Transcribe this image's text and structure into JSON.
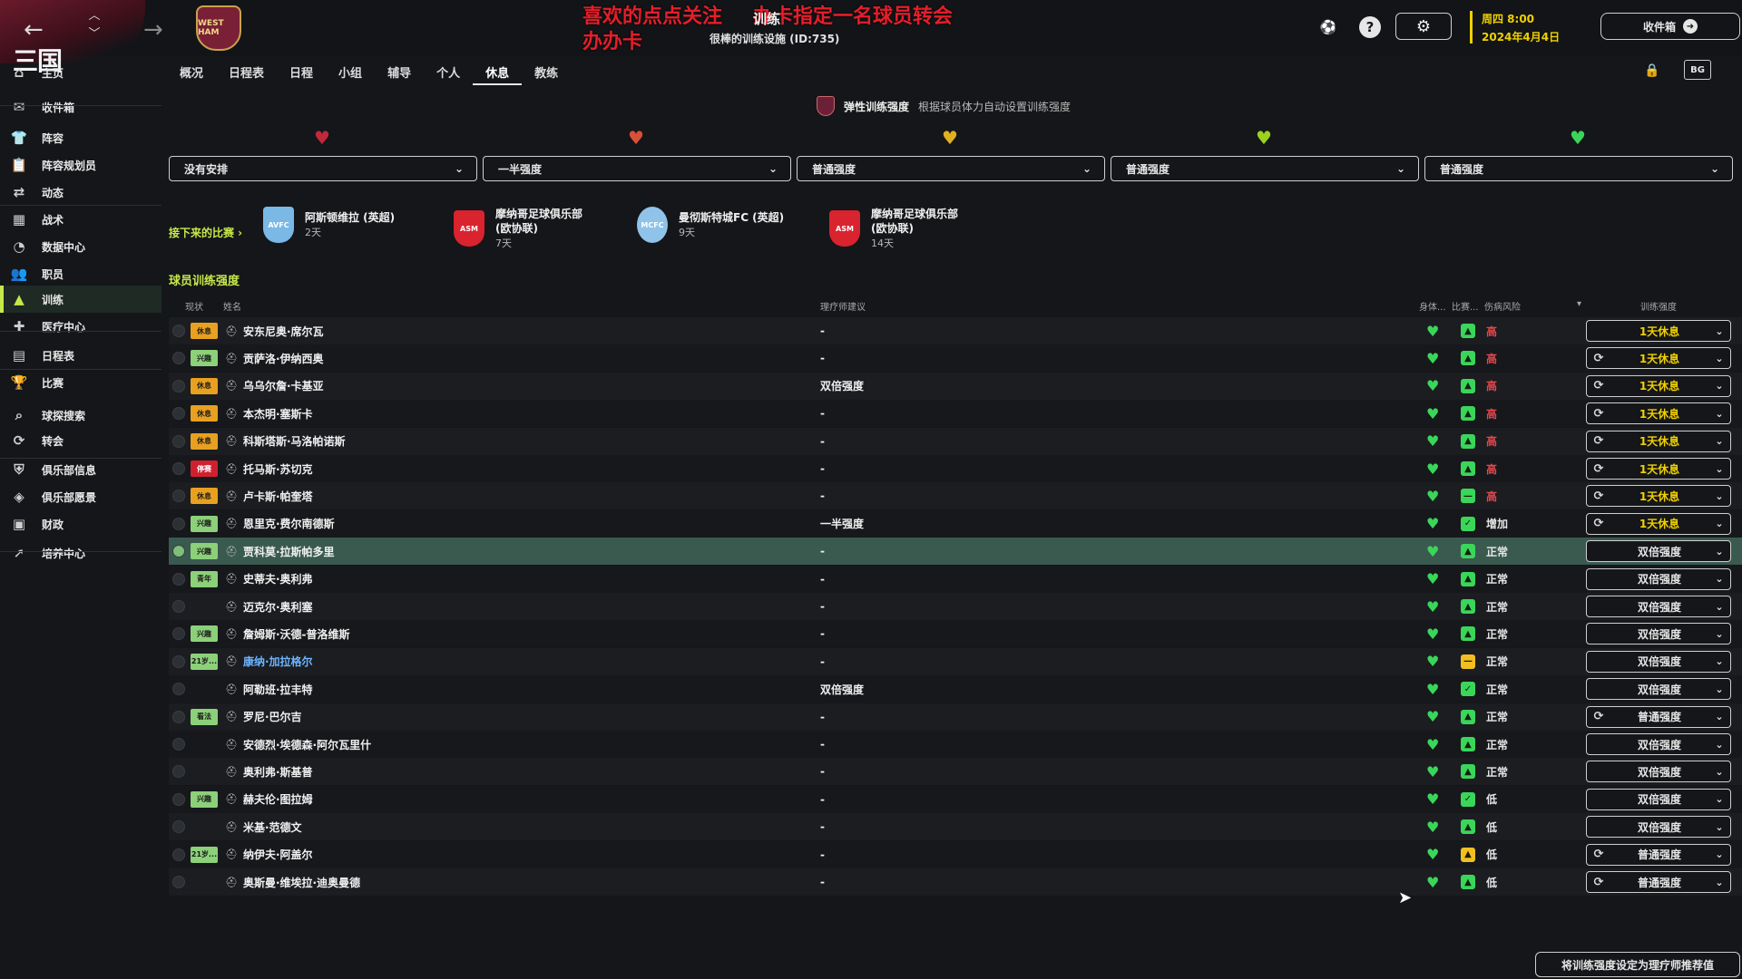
{
  "overlay": {
    "line1": "喜欢的点点关注",
    "line1b": "办卡指定一名球员转会",
    "line2": "办办卡"
  },
  "header": {
    "title": "训练",
    "subtitle": "很棒的训练设施 (ID:735)",
    "date_day": "周四 8:00",
    "date_full": "2024年4月4日",
    "inbox_label": "收件箱",
    "brand": "三国",
    "crest_text": "WEST HAM"
  },
  "sidebar": {
    "items": [
      {
        "label": "主页",
        "icon": "home-icon",
        "glyph": "⌂"
      },
      {
        "label": "收件箱",
        "icon": "inbox-icon",
        "glyph": "✉"
      },
      {
        "label": "阵容",
        "icon": "squad-icon",
        "glyph": "👕"
      },
      {
        "label": "阵容规划员",
        "icon": "squad-planner-icon",
        "glyph": "📋"
      },
      {
        "label": "动态",
        "icon": "dynamics-icon",
        "glyph": "⇄"
      },
      {
        "label": "战术",
        "icon": "tactics-icon",
        "glyph": "▦"
      },
      {
        "label": "数据中心",
        "icon": "data-hub-icon",
        "glyph": "◔"
      },
      {
        "label": "职员",
        "icon": "staff-icon",
        "glyph": "👥"
      },
      {
        "label": "训练",
        "icon": "training-icon",
        "glyph": "▲"
      },
      {
        "label": "医疗中心",
        "icon": "medical-icon",
        "glyph": "✚"
      },
      {
        "label": "日程表",
        "icon": "schedule-icon",
        "glyph": "▤"
      },
      {
        "label": "比赛",
        "icon": "competitions-icon",
        "glyph": "🏆"
      },
      {
        "label": "球探搜索",
        "icon": "scouting-icon",
        "glyph": "⌕"
      },
      {
        "label": "转会",
        "icon": "transfers-icon",
        "glyph": "⟳"
      },
      {
        "label": "俱乐部信息",
        "icon": "club-info-icon",
        "glyph": "⛨"
      },
      {
        "label": "俱乐部愿景",
        "icon": "club-vision-icon",
        "glyph": "◈"
      },
      {
        "label": "财政",
        "icon": "finances-icon",
        "glyph": "▣"
      },
      {
        "label": "培养中心",
        "icon": "development-icon",
        "glyph": "➚"
      }
    ]
  },
  "tabs": [
    "概况",
    "日程表",
    "日程",
    "小组",
    "辅导",
    "个人",
    "休息",
    "教练"
  ],
  "active_tab": "休息",
  "flexible": {
    "label": "弹性训练强度",
    "hint": "根据球员体力自动设置训练强度"
  },
  "day_selects": [
    "没有安排",
    "一半强度",
    "普通强度",
    "普通强度",
    "普通强度"
  ],
  "heart_colors": [
    "#c0283c",
    "#d9503a",
    "#e0b020",
    "#9ad21e",
    "#3ad65a"
  ],
  "upcoming": {
    "label": "接下来的比赛 ›",
    "matches": [
      {
        "name": "阿斯顿维拉 (英超)",
        "days": "2天",
        "badge_color": "#7ab8e6",
        "badge_text": "AVFC"
      },
      {
        "name": "摩纳哥足球俱乐部\n(欧协联)",
        "days": "7天",
        "badge_color": "#d9232e",
        "badge_text": "ASM"
      },
      {
        "name": "曼彻斯特城FC (英超)",
        "days": "9天",
        "badge_color": "#8fc3ea",
        "badge_text": "MCFC"
      },
      {
        "name": "摩纳哥足球俱乐部\n(欧协联)",
        "days": "14天",
        "badge_color": "#d9232e",
        "badge_text": "ASM"
      }
    ]
  },
  "section_title": "球员训练强度",
  "table": {
    "headers": {
      "status": "现状",
      "name": "姓名",
      "advice": "理疗师建议",
      "fitness": "身体...",
      "sharpness": "比赛...",
      "risk": "伤病风险",
      "intensity": "训练强度"
    },
    "rows": [
      {
        "status": "休息",
        "status_color": "#e8a020",
        "name": "安东尼奥·席尔瓦",
        "advice": "-",
        "sharp": "up",
        "risk": "高",
        "risk_color": "#e5484d",
        "intensity": "1天休息",
        "highlight": true,
        "refresh": false
      },
      {
        "status": "兴趣",
        "status_color": "#8cd07a",
        "name": "贡萨洛·伊纳西奥",
        "advice": "-",
        "sharp": "up",
        "risk": "高",
        "risk_color": "#e5484d",
        "intensity": "1天休息",
        "highlight": true,
        "refresh": true
      },
      {
        "status": "休息",
        "status_color": "#e8a020",
        "name": "乌乌尔詹·卡基亚",
        "advice": "双倍强度",
        "sharp": "up",
        "risk": "高",
        "risk_color": "#e5484d",
        "intensity": "1天休息",
        "highlight": true,
        "refresh": true
      },
      {
        "status": "休息",
        "status_color": "#e8a020",
        "name": "本杰明·塞斯卡",
        "advice": "-",
        "sharp": "up",
        "risk": "高",
        "risk_color": "#e5484d",
        "intensity": "1天休息",
        "highlight": true,
        "refresh": true
      },
      {
        "status": "休息",
        "status_color": "#e8a020",
        "name": "科斯塔斯·马洛帕诺斯",
        "advice": "-",
        "sharp": "up",
        "risk": "高",
        "risk_color": "#e5484d",
        "intensity": "1天休息",
        "highlight": true,
        "refresh": true
      },
      {
        "status": "停赛",
        "status_color": "#d02030",
        "name": "托马斯·苏切克",
        "advice": "-",
        "sharp": "up",
        "risk": "高",
        "risk_color": "#e5484d",
        "intensity": "1天休息",
        "highlight": true,
        "refresh": true
      },
      {
        "status": "休息",
        "status_color": "#e8a020",
        "name": "卢卡斯·帕奎塔",
        "advice": "-",
        "sharp": "flat",
        "risk": "高",
        "risk_color": "#e5484d",
        "intensity": "1天休息",
        "highlight": true,
        "refresh": true
      },
      {
        "status": "兴趣",
        "status_color": "#8cd07a",
        "name": "恩里克·费尔南德斯",
        "advice": "一半强度",
        "sharp": "check",
        "risk": "增加",
        "risk_color": "#e6e6e6",
        "intensity": "1天休息",
        "highlight": true,
        "refresh": true
      },
      {
        "status": "兴趣",
        "status_color": "#8cd07a",
        "name": "贾科莫·拉斯帕多里",
        "advice": "-",
        "sharp": "up",
        "risk": "正常",
        "risk_color": "#e6e6e6",
        "intensity": "双倍强度",
        "highlight": false,
        "refresh": false,
        "selected": true
      },
      {
        "status": "青年",
        "status_color": "#8cd07a",
        "name": "史蒂夫·奥利弗",
        "advice": "-",
        "sharp": "up",
        "risk": "正常",
        "risk_color": "#e6e6e6",
        "intensity": "双倍强度",
        "highlight": false,
        "refresh": false
      },
      {
        "status": "",
        "status_color": "",
        "name": "迈克尔·奥利塞",
        "advice": "-",
        "sharp": "up",
        "risk": "正常",
        "risk_color": "#e6e6e6",
        "intensity": "双倍强度",
        "highlight": false,
        "refresh": false
      },
      {
        "status": "兴趣",
        "status_color": "#8cd07a",
        "name": "詹姆斯·沃德-普洛维斯",
        "advice": "-",
        "sharp": "up",
        "risk": "正常",
        "risk_color": "#e6e6e6",
        "intensity": "双倍强度",
        "highlight": false,
        "refresh": false
      },
      {
        "status": "21岁...",
        "status_color": "#8cd07a",
        "name": "康纳·加拉格尔",
        "advice": "-",
        "sharp": "flat-yellow",
        "risk": "正常",
        "risk_color": "#e6e6e6",
        "intensity": "双倍强度",
        "highlight": false,
        "refresh": false,
        "link": true
      },
      {
        "status": "",
        "status_color": "",
        "name": "阿勒班·拉丰特",
        "advice": "双倍强度",
        "sharp": "check",
        "risk": "正常",
        "risk_color": "#e6e6e6",
        "intensity": "双倍强度",
        "highlight": false,
        "refresh": false
      },
      {
        "status": "看法",
        "status_color": "#8cd07a",
        "name": "罗尼·巴尔吉",
        "advice": "-",
        "sharp": "up",
        "risk": "正常",
        "risk_color": "#e6e6e6",
        "intensity": "普通强度",
        "highlight": false,
        "refresh": true
      },
      {
        "status": "",
        "status_color": "",
        "name": "安德烈·埃德森·阿尔瓦里什",
        "advice": "-",
        "sharp": "up",
        "risk": "正常",
        "risk_color": "#e6e6e6",
        "intensity": "双倍强度",
        "highlight": false,
        "refresh": false
      },
      {
        "status": "",
        "status_color": "",
        "name": "奥利弗·斯基普",
        "advice": "-",
        "sharp": "up",
        "risk": "正常",
        "risk_color": "#e6e6e6",
        "intensity": "双倍强度",
        "highlight": false,
        "refresh": false
      },
      {
        "status": "兴趣",
        "status_color": "#8cd07a",
        "name": "赫夫伦·图拉姆",
        "advice": "-",
        "sharp": "check",
        "risk": "低",
        "risk_color": "#e6e6e6",
        "intensity": "双倍强度",
        "highlight": false,
        "refresh": false
      },
      {
        "status": "",
        "status_color": "",
        "name": "米基·范德文",
        "advice": "-",
        "sharp": "up",
        "risk": "低",
        "risk_color": "#e6e6e6",
        "intensity": "双倍强度",
        "highlight": false,
        "refresh": false
      },
      {
        "status": "21岁...",
        "status_color": "#8cd07a",
        "name": "纳伊夫·阿盖尔",
        "advice": "-",
        "sharp": "up-yellow",
        "risk": "低",
        "risk_color": "#e6e6e6",
        "intensity": "普通强度",
        "highlight": false,
        "refresh": true
      },
      {
        "status": "",
        "status_color": "",
        "name": "奥斯曼·维埃拉·迪奥曼德",
        "advice": "-",
        "sharp": "up",
        "risk": "低",
        "risk_color": "#e6e6e6",
        "intensity": "普通强度",
        "highlight": false,
        "refresh": true
      }
    ]
  },
  "footer_button": "将训练强度设定为理疗师推荐值"
}
